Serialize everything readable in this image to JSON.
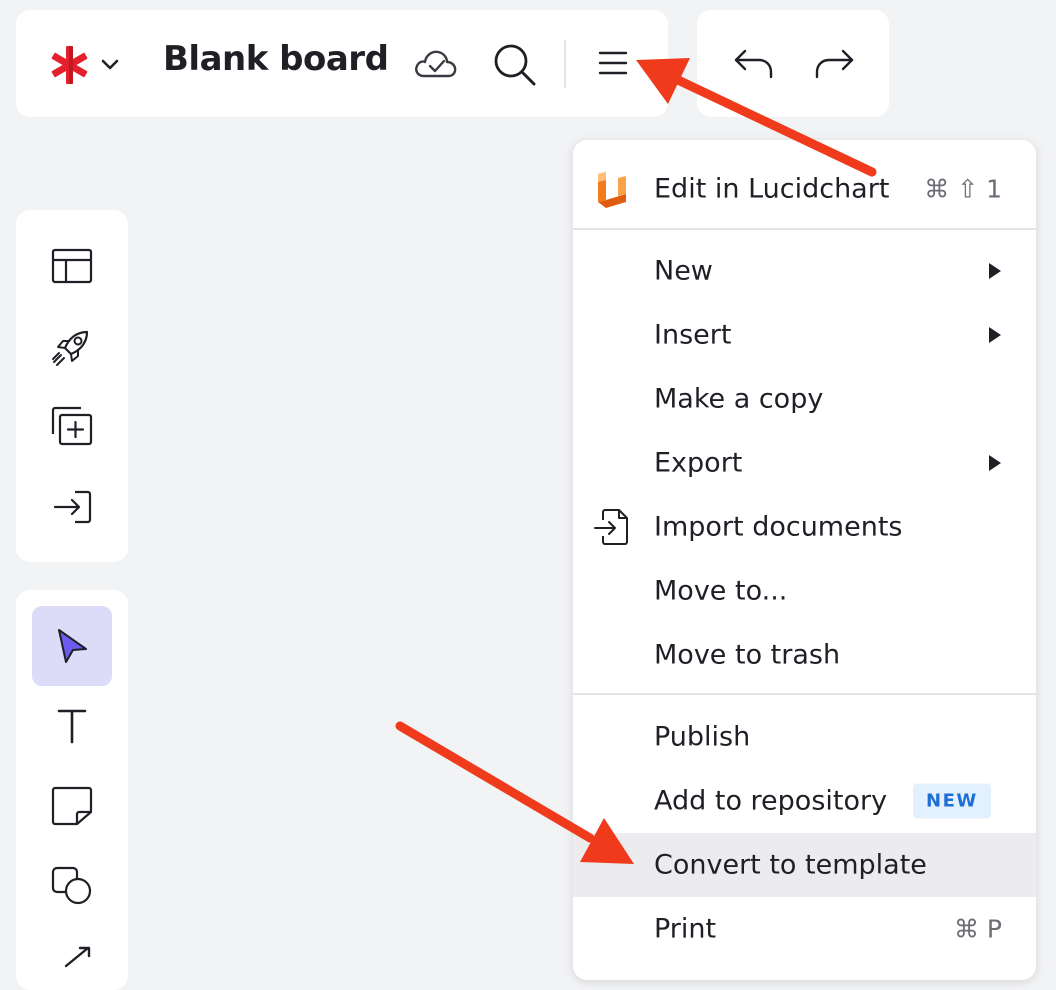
{
  "header": {
    "title": "Blank board"
  },
  "menu": {
    "items": [
      {
        "label": "Edit in Lucidchart",
        "shortcut": "⌘ ⇧ 1"
      },
      {
        "label": "New"
      },
      {
        "label": "Insert"
      },
      {
        "label": "Make a copy"
      },
      {
        "label": "Export"
      },
      {
        "label": "Import documents"
      },
      {
        "label": "Move to..."
      },
      {
        "label": "Move to trash"
      },
      {
        "label": "Publish"
      },
      {
        "label": "Add to repository",
        "badge": "NEW"
      },
      {
        "label": "Convert to template"
      },
      {
        "label": "Print",
        "shortcut": "⌘ P"
      }
    ]
  },
  "colors": {
    "accent_red": "#e8251c",
    "logo_red": "#e3202b",
    "lucidchart_orange": "#f27c1c",
    "selection_bg": "#dcdcf8",
    "pointer_fill": "#6a5cf0",
    "badge_text": "#1d6fd6",
    "annotation_arrow": "#f03a1c"
  },
  "icons": {
    "topbar": [
      "lucid-logo-icon",
      "chevron-down-icon",
      "cloud-saved-icon",
      "search-icon",
      "hamburger-menu-icon",
      "undo-icon",
      "redo-icon"
    ],
    "left_panel_top": [
      "templates-icon",
      "rocket-icon",
      "add-frame-icon",
      "import-icon"
    ],
    "left_panel_tools": [
      "select-pointer-icon",
      "text-icon",
      "sticky-note-icon",
      "shapes-icon",
      "line-icon"
    ]
  }
}
